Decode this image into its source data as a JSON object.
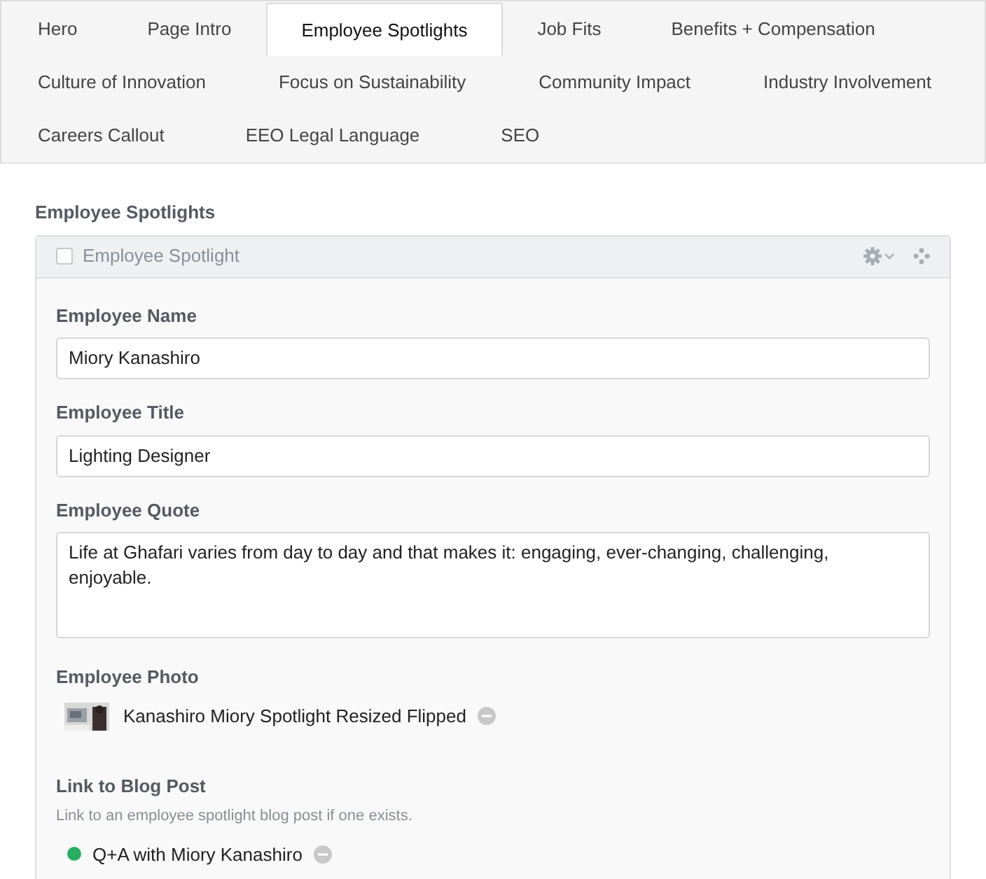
{
  "tab_rows": [
    [
      {
        "label": "Hero",
        "selected": false
      },
      {
        "label": "Page Intro",
        "selected": false
      },
      {
        "label": "Employee Spotlights",
        "selected": true
      },
      {
        "label": "Job Fits",
        "selected": false
      },
      {
        "label": "Benefits + Compensation",
        "selected": false
      }
    ],
    [
      {
        "label": "Culture of Innovation",
        "selected": false
      },
      {
        "label": "Focus on Sustainability",
        "selected": false
      },
      {
        "label": "Community Impact",
        "selected": false
      },
      {
        "label": "Industry Involvement",
        "selected": false
      }
    ],
    [
      {
        "label": "Careers Callout",
        "selected": false
      },
      {
        "label": "EEO Legal Language",
        "selected": false
      },
      {
        "label": "SEO",
        "selected": false
      }
    ]
  ],
  "section_title": "Employee Spotlights",
  "panel": {
    "title": "Employee Spotlight",
    "checked": false,
    "fields": [
      {
        "kind": "input",
        "label": "Employee Name",
        "value": "Miory Kanashiro"
      },
      {
        "kind": "input",
        "label": "Employee Title",
        "value": "Lighting Designer"
      },
      {
        "kind": "textarea",
        "label": "Employee Quote",
        "value": "Life at Ghafari varies from day to day and that makes it: engaging, ever-changing, challenging, enjoyable."
      },
      {
        "label": "Employee Photo",
        "value": "Kanashiro Miory Spotlight Resized Flipped"
      },
      {
        "kind": "link",
        "label": "Link to Blog Post",
        "help": "Link to an employee spotlight blog post if one exists.",
        "value": "Q+A with Miory Kanashiro",
        "color": "#27ae60"
      }
    ]
  }
}
